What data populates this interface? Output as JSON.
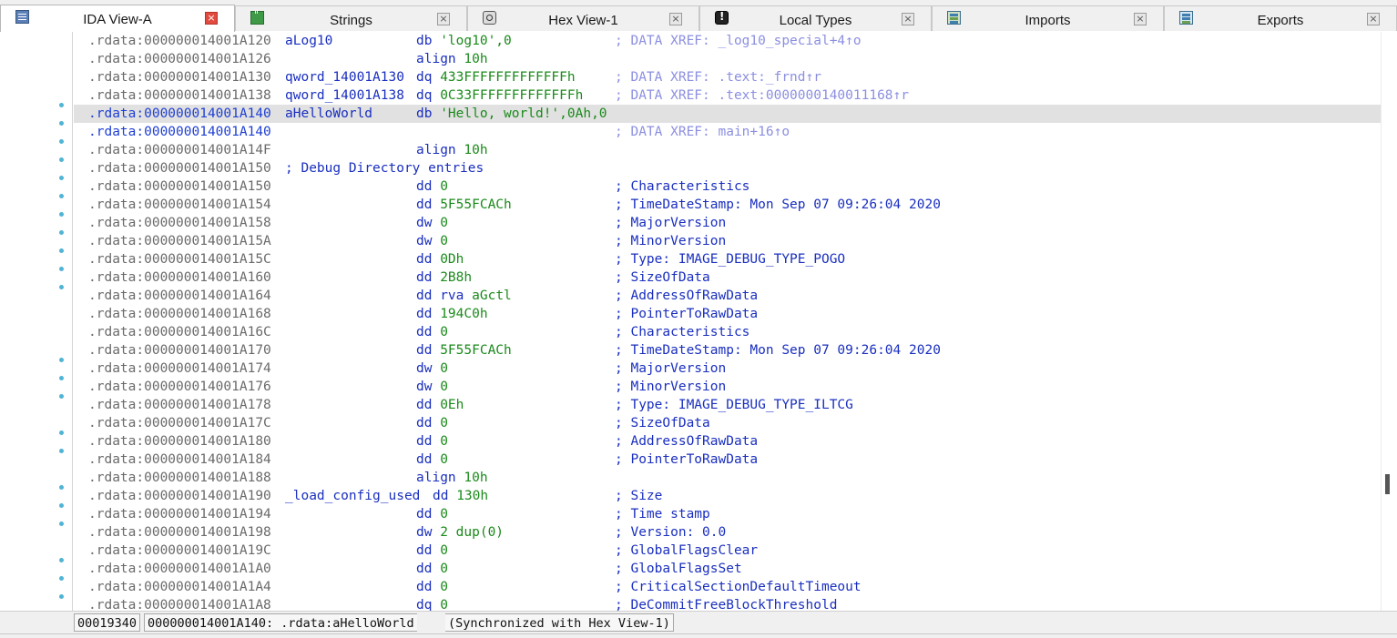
{
  "tabs": [
    {
      "label": "IDA View-A",
      "icon": "listing-icon",
      "active": true
    },
    {
      "label": "Strings",
      "icon": "strings-icon",
      "active": false
    },
    {
      "label": "Hex View-1",
      "icon": "hex-view-icon",
      "active": false
    },
    {
      "label": "Local Types",
      "icon": "local-types-icon",
      "active": false
    },
    {
      "label": "Imports",
      "icon": "imports-icon",
      "active": false
    },
    {
      "label": "Exports",
      "icon": "exports-icon",
      "active": false
    }
  ],
  "close_glyph": "×",
  "listing": [
    {
      "addr": ".rdata:000000014001A120",
      "label": "aLog10",
      "mn": "db",
      "op": "'log10',0",
      "xref": "; DATA XREF: _log10_special+4↑o"
    },
    {
      "addr": ".rdata:000000014001A126",
      "mn": "align",
      "op": "10h"
    },
    {
      "addr": ".rdata:000000014001A130",
      "label": "qword_14001A130",
      "mn": "dq",
      "op": "433FFFFFFFFFFFFFh",
      "xref": "; DATA XREF: .text:_frnd↑r"
    },
    {
      "addr": ".rdata:000000014001A138",
      "label": "qword_14001A138",
      "mn": "dq",
      "op": "0C33FFFFFFFFFFFFFh",
      "xref": "; DATA XREF: .text:0000000140011168↑r"
    },
    {
      "addr": ".rdata:000000014001A140",
      "label": "aHelloWorld",
      "mn": "db",
      "op": "'Hello, world!',0Ah,0",
      "current": true,
      "highlight": true
    },
    {
      "addr": ".rdata:000000014001A140",
      "xref": "; DATA XREF: main+16↑o",
      "current": true
    },
    {
      "addr": ".rdata:000000014001A14F",
      "mn": "align",
      "op": "10h"
    },
    {
      "addr": ".rdata:000000014001A150",
      "section": "; Debug Directory entries"
    },
    {
      "addr": ".rdata:000000014001A150",
      "mn": "dd",
      "op": "0",
      "cmt": "; Characteristics"
    },
    {
      "addr": ".rdata:000000014001A154",
      "mn": "dd",
      "op": "5F55FCACh",
      "cmt": "; TimeDateStamp: Mon Sep 07 09:26:04 2020"
    },
    {
      "addr": ".rdata:000000014001A158",
      "mn": "dw",
      "op": "0",
      "cmt": "; MajorVersion"
    },
    {
      "addr": ".rdata:000000014001A15A",
      "mn": "dw",
      "op": "0",
      "cmt": "; MinorVersion"
    },
    {
      "addr": ".rdata:000000014001A15C",
      "mn": "dd",
      "op": "0Dh",
      "cmt": "; Type: IMAGE_DEBUG_TYPE_POGO"
    },
    {
      "addr": ".rdata:000000014001A160",
      "mn": "dd",
      "op": "2B8h",
      "cmt": "; SizeOfData"
    },
    {
      "addr": ".rdata:000000014001A164",
      "mn": "dd rva",
      "op": "aGctl",
      "cmt": "; AddressOfRawData"
    },
    {
      "addr": ".rdata:000000014001A168",
      "mn": "dd",
      "op": "194C0h",
      "cmt": "; PointerToRawData"
    },
    {
      "addr": ".rdata:000000014001A16C",
      "mn": "dd",
      "op": "0",
      "cmt": "; Characteristics"
    },
    {
      "addr": ".rdata:000000014001A170",
      "mn": "dd",
      "op": "5F55FCACh",
      "cmt": "; TimeDateStamp: Mon Sep 07 09:26:04 2020"
    },
    {
      "addr": ".rdata:000000014001A174",
      "mn": "dw",
      "op": "0",
      "cmt": "; MajorVersion"
    },
    {
      "addr": ".rdata:000000014001A176",
      "mn": "dw",
      "op": "0",
      "cmt": "; MinorVersion"
    },
    {
      "addr": ".rdata:000000014001A178",
      "mn": "dd",
      "op": "0Eh",
      "cmt": "; Type: IMAGE_DEBUG_TYPE_ILTCG"
    },
    {
      "addr": ".rdata:000000014001A17C",
      "mn": "dd",
      "op": "0",
      "cmt": "; SizeOfData"
    },
    {
      "addr": ".rdata:000000014001A180",
      "mn": "dd",
      "op": "0",
      "cmt": "; AddressOfRawData"
    },
    {
      "addr": ".rdata:000000014001A184",
      "mn": "dd",
      "op": "0",
      "cmt": "; PointerToRawData"
    },
    {
      "addr": ".rdata:000000014001A188",
      "mn": "align",
      "op": "10h"
    },
    {
      "addr": ".rdata:000000014001A190",
      "label": "_load_config_used",
      "mn": "dd",
      "op": "130h",
      "cmt": "; Size",
      "long_label": true
    },
    {
      "addr": ".rdata:000000014001A194",
      "mn": "dd",
      "op": "0",
      "cmt": "; Time stamp"
    },
    {
      "addr": ".rdata:000000014001A198",
      "mn": "dw",
      "op": "2 dup(0)",
      "cmt": "; Version: 0.0"
    },
    {
      "addr": ".rdata:000000014001A19C",
      "mn": "dd",
      "op": "0",
      "cmt": "; GlobalFlagsClear"
    },
    {
      "addr": ".rdata:000000014001A1A0",
      "mn": "dd",
      "op": "0",
      "cmt": "; GlobalFlagsSet"
    },
    {
      "addr": ".rdata:000000014001A1A4",
      "mn": "dd",
      "op": "0",
      "cmt": "; CriticalSectionDefaultTimeout"
    },
    {
      "addr": ".rdata:000000014001A1A8",
      "mn": "dq",
      "op": "0",
      "cmt": "; DeCommitFreeBlockThreshold"
    }
  ],
  "status": {
    "offset": "00019340",
    "location": "000000014001A140: .rdata:aHelloWorld",
    "sync": "(Synchronized with Hex View-1)"
  },
  "colors": {
    "address": "#6a6a6a",
    "current_address": "#1f3fd4",
    "name": "#1a2fbf",
    "operand": "#1a8a1a",
    "xref": "#8c8fe0",
    "highlight_row": "#e1e1e1",
    "gutter_dot": "#4fb4d6",
    "active_close": "#e04a3f"
  }
}
